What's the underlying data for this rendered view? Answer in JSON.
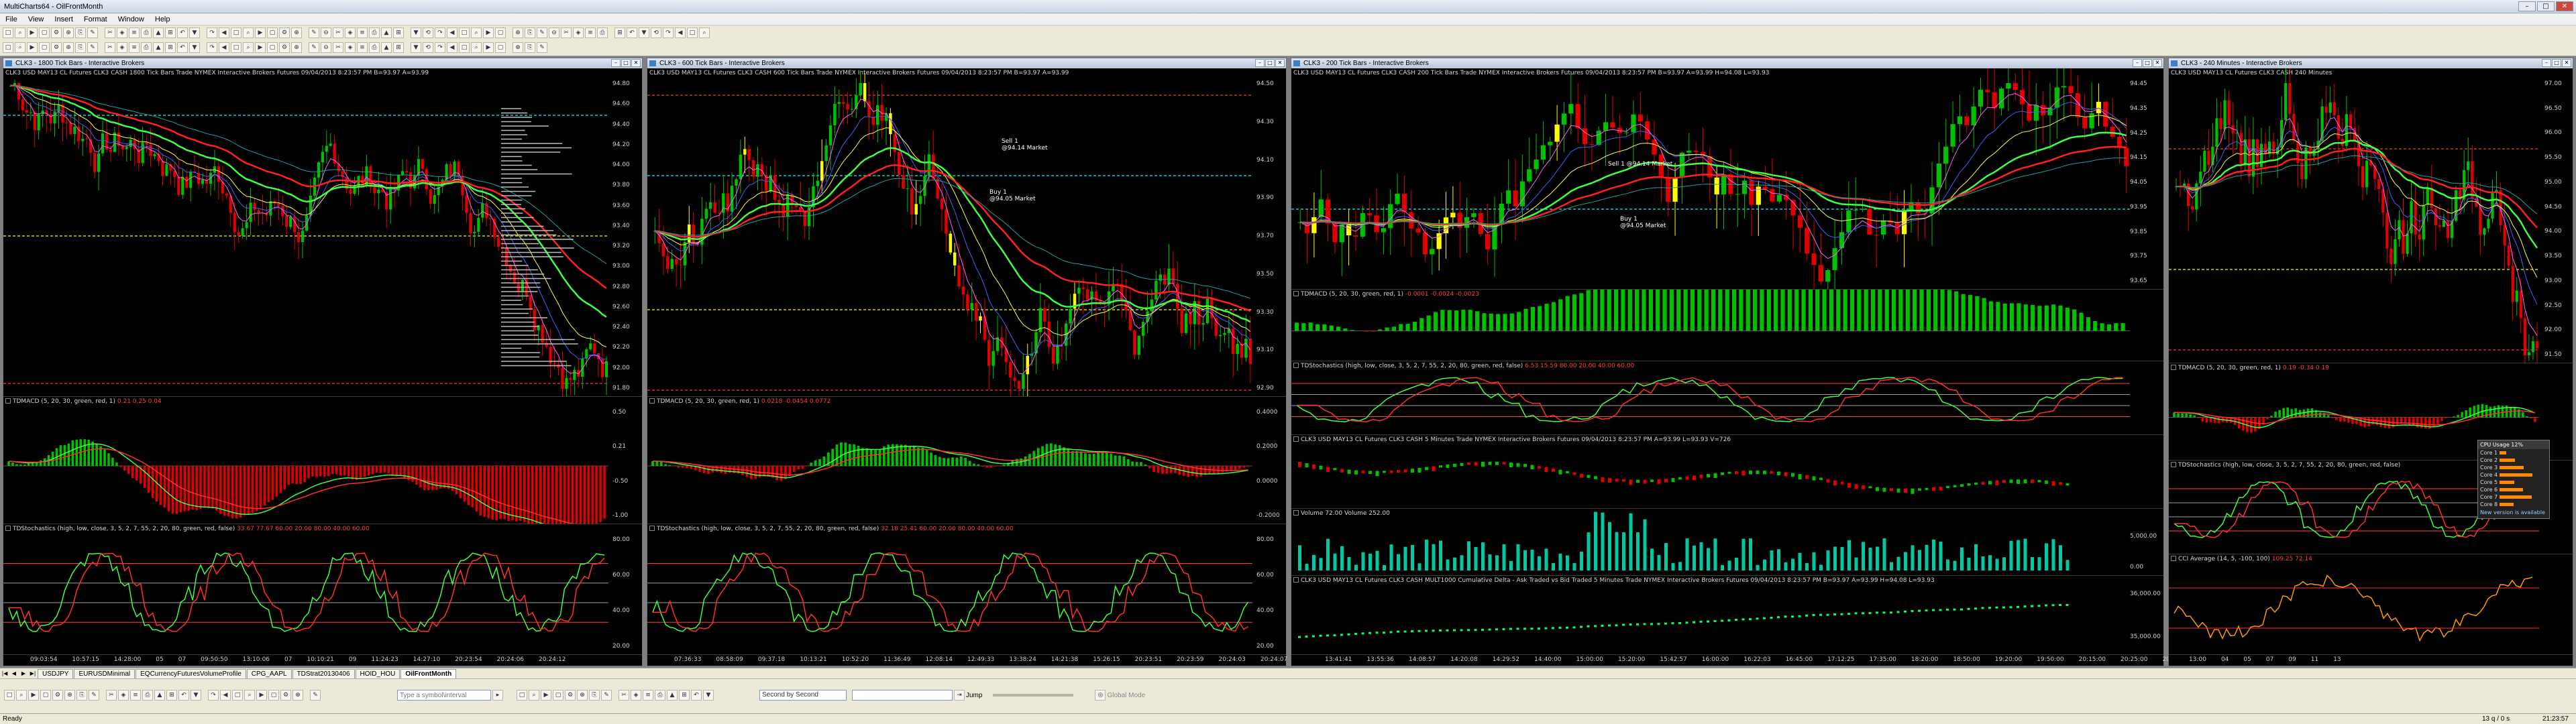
{
  "app": {
    "title": "MultiCharts64 - OilFrontMonth"
  },
  "menu": [
    "File",
    "View",
    "Insert",
    "Format",
    "Window",
    "Help"
  ],
  "windows": [
    {
      "title": "CLK3 - 1800 Tick Bars - Interactive Brokers",
      "header": "CLK3  USD MAY13 CL Futures CLK3 CASH  1800 Tick Bars   Trade  NYMEX  Interactive Brokers  Futures  09/04/2013  8:23:57 PM  B=93.97  A=93.99",
      "price_ticks": [
        "94.80",
        "94.60",
        "94.40",
        "94.20",
        "94.00",
        "93.80",
        "93.60",
        "93.40",
        "93.20",
        "93.00",
        "92.80",
        "92.60",
        "92.40",
        "92.20",
        "92.00",
        "91.80"
      ],
      "macd_label": "TDMACD (5, 20, 30, green, red, 1)",
      "macd_vals": "0.21  0.25  0.04",
      "macd_ticks": [
        "0.50",
        "0.21",
        "-0.50",
        "-1.00"
      ],
      "stoch_label": "TDStochastics (high, low, close, 3, 5, 2, 7, 55, 2, 20, 80, green, red, false)",
      "stoch_vals": "33.67  77.67  60.00  20.00  80.00  40.00  60.00",
      "stoch_ticks": [
        "80.00",
        "60.00",
        "40.00",
        "20.00"
      ],
      "time_labels": [
        "09:03:54",
        "10:57:15",
        "14:28:00",
        "05",
        "07",
        "09:50:50",
        "13:10:06",
        "07",
        "10:10:21",
        "09",
        "11:24:23",
        "14:27:10",
        "20:23:54",
        "20:24:06",
        "20:24:12"
      ]
    },
    {
      "title": "CLK3 - 600 Tick Bars - Interactive Brokers",
      "header": "CLK3  USD MAY13 CL Futures CLK3 CASH  600 Tick Bars   Trade  NYMEX  Interactive Brokers  Futures  09/04/2013  8:23:57 PM  B=93.97  A=93.99",
      "price_ticks": [
        "94.50",
        "94.30",
        "94.10",
        "93.90",
        "93.70",
        "93.50",
        "93.30",
        "93.10",
        "92.90"
      ],
      "orders": {
        "sell": "Sell 1",
        "sell_price": "@94.14 Market",
        "buy": "Buy 1",
        "buy_price": "@94.05 Market"
      },
      "macd_label": "TDMACD (5, 20, 30, green, red, 1)",
      "macd_vals": "0.0218  -0.0454  0.0772",
      "macd_ticks": [
        "0.4000",
        "0.2000",
        "0.0000",
        "-0.2000"
      ],
      "stoch_label": "TDStochastics (high, low, close, 3, 5, 2, 7, 55, 2, 20, 80, green, red, false)",
      "stoch_vals": "32.18  25.41  60.00  20.00  80.00  40.00  60.00",
      "stoch_ticks": [
        "80.00",
        "60.00",
        "40.00",
        "20.00"
      ],
      "time_labels": [
        "07:36:33",
        "08:58:09",
        "09:37:18",
        "10:13:21",
        "10:52:20",
        "11:36:49",
        "12:08:14",
        "12:49:33",
        "13:38:24",
        "14:21:38",
        "15:26:15",
        "20:23:51",
        "20:23:59",
        "20:24:03",
        "20:24:07",
        "20:24:11"
      ]
    },
    {
      "title": "CLK3 - 200 Tick Bars - Interactive Brokers",
      "header": "CLK3  USD MAY13 CL Futures CLK3 CASH  200 Tick Bars   Trade  NYMEX  Interactive Brokers  Futures  09/04/2013  8:23:57 PM  B=93.97  A=93.99  H=94.08  L=93.93",
      "price_ticks": [
        "94.45",
        "94.35",
        "94.25",
        "94.15",
        "94.05",
        "93.95",
        "93.85",
        "93.75",
        "93.65"
      ],
      "orders": {
        "sell": "Sell 1",
        "sell_price": "@94.14 Market",
        "buy": "Buy 1",
        "buy_price": "@94.05 Market"
      },
      "macd_label": "TDMACD (5, 20, 30, green, red, 1)",
      "macd_vals": "-0.0001  -0.0024  -0.0023",
      "stoch_label": "TDStochastics (high, low, close, 3, 5, 2, 7, 55, 2, 20, 80, green, red, false)",
      "stoch_vals": "6.53  15.59  80.00  20.00  40.00  60.00",
      "stoch_ticks": [
        "80.00",
        "60.00",
        "40.00",
        "20.00"
      ],
      "tick5_header": "CLK3  USD MAY13 CL Futures CLK3 CASH  5 Minutes   Trade  NYMEX  Interactive Brokers  Futures  09/04/2013  8:23:57 PM  A=93.99  L=93.93  V=726",
      "volume_label": "Volume  72.00",
      "volume_label2": "Volume  252.00",
      "volume_ticks": [
        "5,000.00",
        "0.00"
      ],
      "cum_label": "CLK3  USD MAY13 CL Futures CLK3 CASH  MULT1000   Cumulative Delta - Ask Traded vs Bid Traded  5 Minutes   Trade  NYMEX  Interactive Brokers  Futures  09/04/2013  8:23:57 PM  B=93.97  A=93.99  H=94.08  L=93.93",
      "cum_ticks": [
        "36,000.00",
        "35,000.00"
      ],
      "time_labels": [
        "13:41:41",
        "13:55:36",
        "14:08:57",
        "14:20:08",
        "14:29:52",
        "14:40:00",
        "15:00:00",
        "15:20:00",
        "15:42:57",
        "16:00:00",
        "16:22:03",
        "16:45:00",
        "17:12:25",
        "17:35:00",
        "18:20:00",
        "18:50:00",
        "19:20:00",
        "19:50:00",
        "20:15:00",
        "20:25:00",
        "20:25:09",
        "20:25:15",
        "20:25:21"
      ]
    },
    {
      "title": "CLK3 - 240 Minutes - Interactive Brokers",
      "header": "CLK3  USD MAY13 CL Futures CLK3 CASH  240 Minutes",
      "price_ticks": [
        "97.00",
        "96.50",
        "96.00",
        "95.50",
        "95.00",
        "94.50",
        "94.00",
        "93.50",
        "93.00",
        "92.50",
        "92.00",
        "91.50"
      ],
      "macd_label": "TDMACD (5, 20, 30, green, red, 1)",
      "macd_vals": "0.19  -0.34  0.19",
      "stoch_label": "TDStochastics (high, low, close, 3, 5, 2, 7, 55, 2, 20, 80, green, red, false)",
      "cci_label": "CCI Average (14, 5, -100, 100)",
      "cci_vals": "109.25  72.14",
      "time_labels": [
        "13:00",
        "04",
        "05",
        "07",
        "09",
        "11",
        "13"
      ]
    }
  ],
  "cpu_widget": {
    "title": "CPU Usage",
    "value": "12%",
    "cores": [
      "Core 1",
      "Core 2",
      "Core 3",
      "Core 4",
      "Core 5",
      "Core 6",
      "Core 7",
      "Core 8"
    ],
    "footer": "New version is available"
  },
  "tabs": [
    "USDJPY",
    "EURUSDMinimal",
    "EQCurrencyFuturesVolumeProfile",
    "CPG_AAPL",
    "TDStrat20130406",
    "HOID_HOU",
    "OilFrontMonth"
  ],
  "active_tab": "OilFrontMonth",
  "bottom": {
    "symbol_placeholder": "Type a symbol\\interval",
    "resolution": "Second by Second",
    "jump_label": "Jump",
    "global_mode": "Global Mode"
  },
  "status": {
    "left": "Ready",
    "right1": "13 q / 0 s",
    "right2": "21:23:57"
  },
  "colors": {
    "bg": "#000000",
    "up": "#00c000",
    "down": "#d00000",
    "ema_red": "#ff2020",
    "ema_green": "#40ff40",
    "accent_yellow": "#ffff00"
  }
}
